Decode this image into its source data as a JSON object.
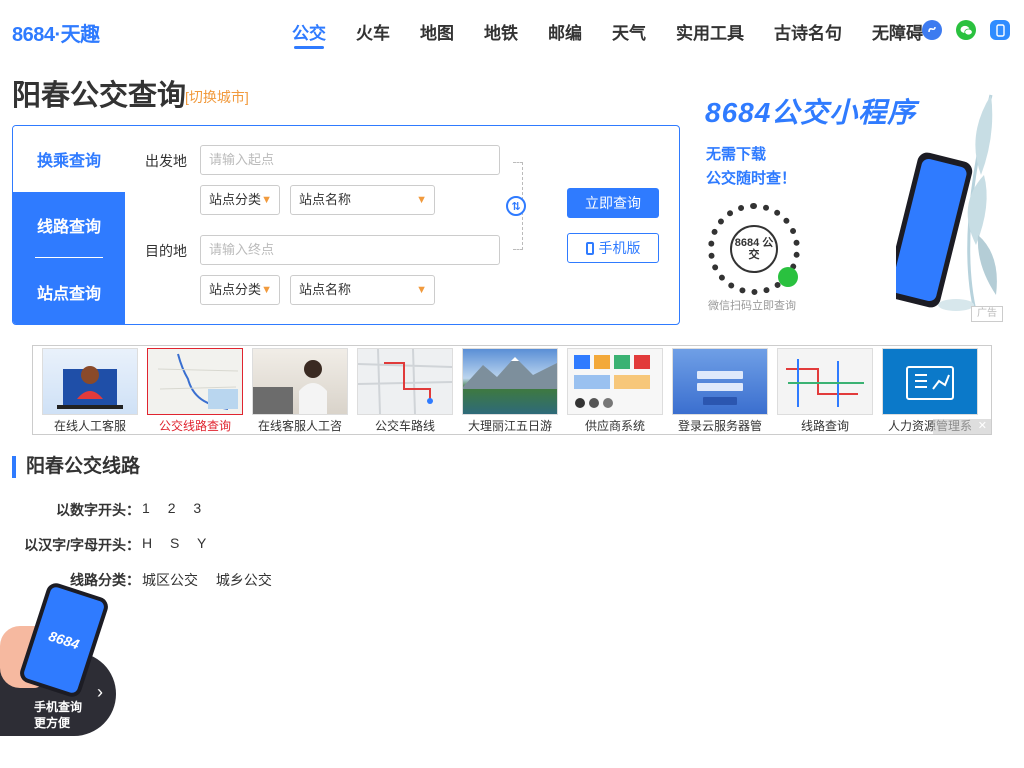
{
  "header": {
    "logo": "8684·天趣",
    "nav": [
      "公交",
      "火车",
      "地图",
      "地铁",
      "邮编",
      "天气",
      "实用工具",
      "古诗名句",
      "无障碍"
    ],
    "active_nav": "公交",
    "icons": [
      "mini-program-icon",
      "wechat-icon",
      "mobile-icon"
    ],
    "accent_color": "#2f7bff"
  },
  "page": {
    "title": "阳春公交查询",
    "switch_city": "[切换城市]"
  },
  "search": {
    "tabs": [
      "换乘查询",
      "线路查询",
      "站点查询"
    ],
    "active_tab": "换乘查询",
    "from_label": "出发地",
    "from_placeholder": "请输入起点",
    "to_label": "目的地",
    "to_placeholder": "请输入终点",
    "category_select": "站点分类",
    "name_select": "站点名称",
    "query_button": "立即查询",
    "mobile_button": "手机版"
  },
  "promo": {
    "title": "8684公交小程序",
    "line1": "无需下载",
    "line2": "公交随时查！",
    "qr_label": "8684 公交",
    "caption": "微信扫码立即查询",
    "ad_tag": "广告"
  },
  "ad_strip": {
    "items": [
      "在线人工客服",
      "公交线路查询",
      "在线客服人工咨",
      "公交车路线",
      "大理丽江五日游",
      "供应商系统",
      "登录云服务器管",
      "线路查询",
      "人力资源管理系"
    ],
    "selected_index": 1
  },
  "lines": {
    "section_title": "阳春公交线路",
    "rows": [
      {
        "label": "以数字开头：",
        "values": [
          "1",
          "2",
          "3"
        ]
      },
      {
        "label": "以汉字/字母开头：",
        "values": [
          "H",
          "S",
          "Y"
        ]
      },
      {
        "label": "线路分类：",
        "values": [
          "城区公交",
          "城乡公交"
        ]
      }
    ]
  },
  "float_badge": {
    "brand": "8684",
    "line1": "手机查询",
    "line2": "更方便"
  }
}
